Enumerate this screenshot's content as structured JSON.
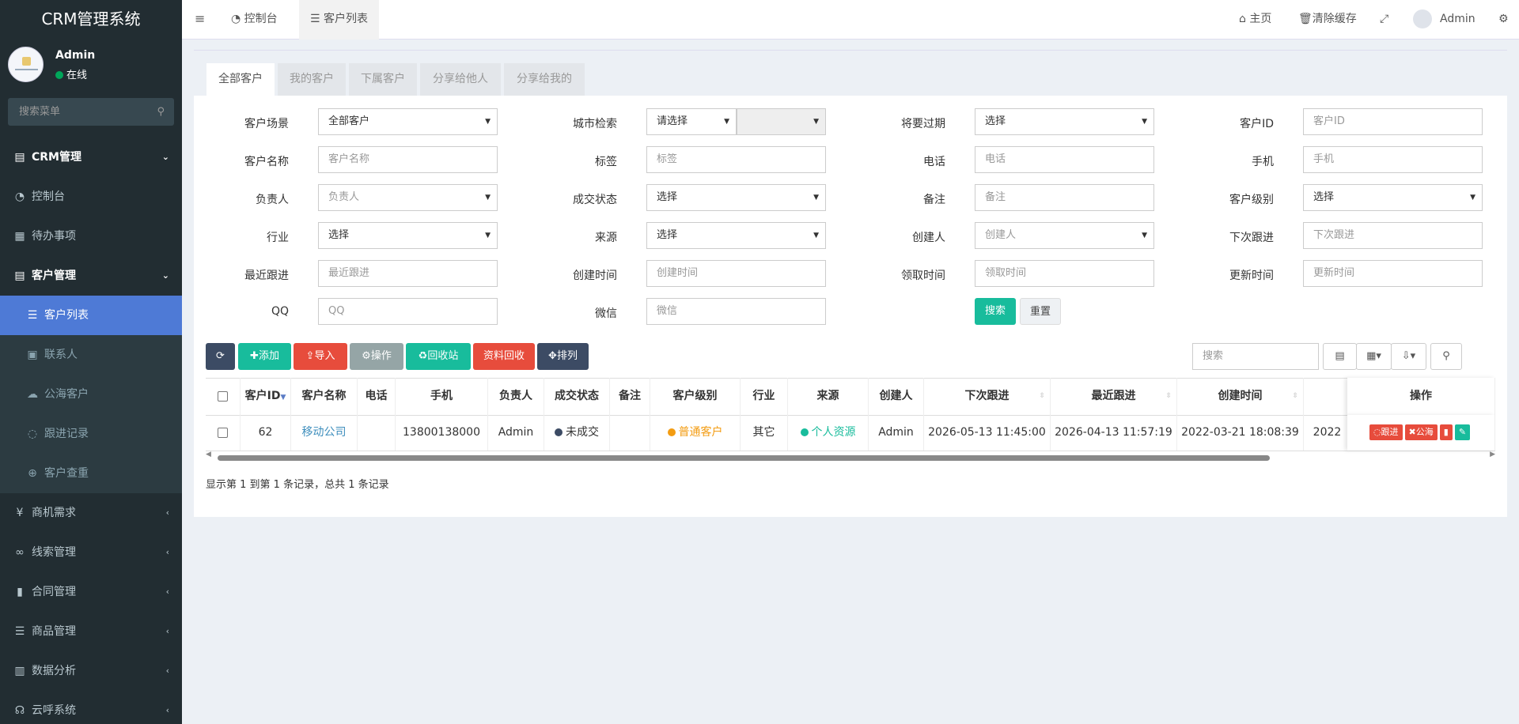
{
  "app": {
    "title": "CRM管理系统"
  },
  "user": {
    "name": "Admin",
    "status": "在线",
    "status_color": "#00a65a"
  },
  "sidebar": {
    "search_placeholder": "搜索菜单",
    "items": [
      {
        "label": "CRM管理",
        "icon": "id-card-icon"
      },
      {
        "label": "控制台",
        "icon": "dashboard-icon"
      },
      {
        "label": "待办事项",
        "icon": "calendar-icon"
      },
      {
        "label": "客户管理",
        "icon": "id-card-icon"
      },
      {
        "label": "客户列表",
        "icon": "list-icon"
      },
      {
        "label": "联系人",
        "icon": "contact-icon"
      },
      {
        "label": "公海客户",
        "icon": "cloud-icon"
      },
      {
        "label": "跟进记录",
        "icon": "comment-icon"
      },
      {
        "label": "客户查重",
        "icon": "search-plus-icon"
      },
      {
        "label": "商机需求",
        "icon": "yen-icon"
      },
      {
        "label": "线索管理",
        "icon": "link-icon"
      },
      {
        "label": "合同管理",
        "icon": "bookmark-icon"
      },
      {
        "label": "商品管理",
        "icon": "list-icon"
      },
      {
        "label": "数据分析",
        "icon": "bar-chart-icon"
      },
      {
        "label": "云呼系统",
        "icon": "headset-icon"
      }
    ]
  },
  "topbar": {
    "tabs": [
      {
        "label": "控制台"
      },
      {
        "label": "客户列表"
      }
    ],
    "home": "主页",
    "clear_cache": "清除缓存",
    "admin": "Admin"
  },
  "content_tabs": [
    "全部客户",
    "我的客户",
    "下属客户",
    "分享给他人",
    "分享给我的"
  ],
  "filters": {
    "scene": {
      "label": "客户场景",
      "value": "全部客户"
    },
    "city": {
      "label": "城市检索",
      "value": "请选择"
    },
    "expire": {
      "label": "将要过期",
      "value": "选择"
    },
    "cid": {
      "label": "客户ID",
      "placeholder": "客户ID"
    },
    "cname": {
      "label": "客户名称",
      "placeholder": "客户名称"
    },
    "tag": {
      "label": "标签",
      "placeholder": "标签"
    },
    "phone": {
      "label": "电话",
      "placeholder": "电话"
    },
    "mobile": {
      "label": "手机",
      "placeholder": "手机"
    },
    "owner": {
      "label": "负责人",
      "placeholder": "负责人"
    },
    "deal": {
      "label": "成交状态",
      "value": "选择"
    },
    "remark": {
      "label": "备注",
      "placeholder": "备注"
    },
    "level": {
      "label": "客户级别",
      "value": "选择"
    },
    "industry": {
      "label": "行业",
      "value": "选择"
    },
    "source": {
      "label": "来源",
      "value": "选择"
    },
    "creator": {
      "label": "创建人",
      "placeholder": "创建人"
    },
    "next_follow": {
      "label": "下次跟进",
      "placeholder": "下次跟进"
    },
    "last_follow": {
      "label": "最近跟进",
      "placeholder": "最近跟进"
    },
    "created": {
      "label": "创建时间",
      "placeholder": "创建时间"
    },
    "claimed": {
      "label": "领取时间",
      "placeholder": "领取时间"
    },
    "updated": {
      "label": "更新时间",
      "placeholder": "更新时间"
    },
    "qq": {
      "label": "QQ",
      "placeholder": "QQ"
    },
    "wechat": {
      "label": "微信",
      "placeholder": "微信"
    },
    "search_btn": "搜索",
    "reset_btn": "重置"
  },
  "toolbar": {
    "add": "添加",
    "import": "导入",
    "operate": "操作",
    "recycle": "回收站",
    "data_recycle": "资料回收",
    "sort": "排列",
    "search_placeholder": "搜索",
    "colors": {
      "dark": "#3c4b64",
      "green": "#18bc9c",
      "red": "#e74c3c",
      "gray": "#95a5a6"
    }
  },
  "table": {
    "headers": [
      "客户ID",
      "客户名称",
      "电话",
      "手机",
      "负责人",
      "成交状态",
      "备注",
      "客户级别",
      "行业",
      "来源",
      "创建人",
      "下次跟进",
      "最近跟进",
      "创建时间",
      "操作"
    ],
    "row": {
      "id": "62",
      "name": "移动公司",
      "phone": "",
      "mobile": "13800138000",
      "owner": "Admin",
      "deal": "未成交",
      "remark": "",
      "level": "普通客户",
      "industry": "其它",
      "source": "个人资源",
      "creator": "Admin",
      "next_follow": "2026-05-13 11:45:00",
      "last_follow": "2026-04-13 11:57:19",
      "created": "2022-03-21 18:08:39",
      "partial": "2022"
    },
    "actions": {
      "follow": "跟进",
      "pool": "公海"
    },
    "footer": "显示第 1 到第 1 条记录，总共 1 条记录"
  }
}
